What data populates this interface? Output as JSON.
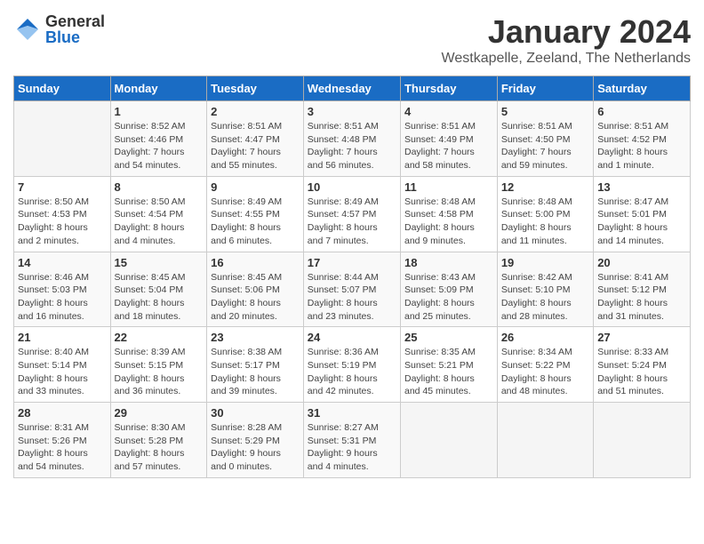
{
  "logo": {
    "general": "General",
    "blue": "Blue"
  },
  "title": "January 2024",
  "subtitle": "Westkapelle, Zeeland, The Netherlands",
  "days_of_week": [
    "Sunday",
    "Monday",
    "Tuesday",
    "Wednesday",
    "Thursday",
    "Friday",
    "Saturday"
  ],
  "weeks": [
    [
      {
        "day": "",
        "info": ""
      },
      {
        "day": "1",
        "info": "Sunrise: 8:52 AM\nSunset: 4:46 PM\nDaylight: 7 hours\nand 54 minutes."
      },
      {
        "day": "2",
        "info": "Sunrise: 8:51 AM\nSunset: 4:47 PM\nDaylight: 7 hours\nand 55 minutes."
      },
      {
        "day": "3",
        "info": "Sunrise: 8:51 AM\nSunset: 4:48 PM\nDaylight: 7 hours\nand 56 minutes."
      },
      {
        "day": "4",
        "info": "Sunrise: 8:51 AM\nSunset: 4:49 PM\nDaylight: 7 hours\nand 58 minutes."
      },
      {
        "day": "5",
        "info": "Sunrise: 8:51 AM\nSunset: 4:50 PM\nDaylight: 7 hours\nand 59 minutes."
      },
      {
        "day": "6",
        "info": "Sunrise: 8:51 AM\nSunset: 4:52 PM\nDaylight: 8 hours\nand 1 minute."
      }
    ],
    [
      {
        "day": "7",
        "info": "Sunrise: 8:50 AM\nSunset: 4:53 PM\nDaylight: 8 hours\nand 2 minutes."
      },
      {
        "day": "8",
        "info": "Sunrise: 8:50 AM\nSunset: 4:54 PM\nDaylight: 8 hours\nand 4 minutes."
      },
      {
        "day": "9",
        "info": "Sunrise: 8:49 AM\nSunset: 4:55 PM\nDaylight: 8 hours\nand 6 minutes."
      },
      {
        "day": "10",
        "info": "Sunrise: 8:49 AM\nSunset: 4:57 PM\nDaylight: 8 hours\nand 7 minutes."
      },
      {
        "day": "11",
        "info": "Sunrise: 8:48 AM\nSunset: 4:58 PM\nDaylight: 8 hours\nand 9 minutes."
      },
      {
        "day": "12",
        "info": "Sunrise: 8:48 AM\nSunset: 5:00 PM\nDaylight: 8 hours\nand 11 minutes."
      },
      {
        "day": "13",
        "info": "Sunrise: 8:47 AM\nSunset: 5:01 PM\nDaylight: 8 hours\nand 14 minutes."
      }
    ],
    [
      {
        "day": "14",
        "info": "Sunrise: 8:46 AM\nSunset: 5:03 PM\nDaylight: 8 hours\nand 16 minutes."
      },
      {
        "day": "15",
        "info": "Sunrise: 8:45 AM\nSunset: 5:04 PM\nDaylight: 8 hours\nand 18 minutes."
      },
      {
        "day": "16",
        "info": "Sunrise: 8:45 AM\nSunset: 5:06 PM\nDaylight: 8 hours\nand 20 minutes."
      },
      {
        "day": "17",
        "info": "Sunrise: 8:44 AM\nSunset: 5:07 PM\nDaylight: 8 hours\nand 23 minutes."
      },
      {
        "day": "18",
        "info": "Sunrise: 8:43 AM\nSunset: 5:09 PM\nDaylight: 8 hours\nand 25 minutes."
      },
      {
        "day": "19",
        "info": "Sunrise: 8:42 AM\nSunset: 5:10 PM\nDaylight: 8 hours\nand 28 minutes."
      },
      {
        "day": "20",
        "info": "Sunrise: 8:41 AM\nSunset: 5:12 PM\nDaylight: 8 hours\nand 31 minutes."
      }
    ],
    [
      {
        "day": "21",
        "info": "Sunrise: 8:40 AM\nSunset: 5:14 PM\nDaylight: 8 hours\nand 33 minutes."
      },
      {
        "day": "22",
        "info": "Sunrise: 8:39 AM\nSunset: 5:15 PM\nDaylight: 8 hours\nand 36 minutes."
      },
      {
        "day": "23",
        "info": "Sunrise: 8:38 AM\nSunset: 5:17 PM\nDaylight: 8 hours\nand 39 minutes."
      },
      {
        "day": "24",
        "info": "Sunrise: 8:36 AM\nSunset: 5:19 PM\nDaylight: 8 hours\nand 42 minutes."
      },
      {
        "day": "25",
        "info": "Sunrise: 8:35 AM\nSunset: 5:21 PM\nDaylight: 8 hours\nand 45 minutes."
      },
      {
        "day": "26",
        "info": "Sunrise: 8:34 AM\nSunset: 5:22 PM\nDaylight: 8 hours\nand 48 minutes."
      },
      {
        "day": "27",
        "info": "Sunrise: 8:33 AM\nSunset: 5:24 PM\nDaylight: 8 hours\nand 51 minutes."
      }
    ],
    [
      {
        "day": "28",
        "info": "Sunrise: 8:31 AM\nSunset: 5:26 PM\nDaylight: 8 hours\nand 54 minutes."
      },
      {
        "day": "29",
        "info": "Sunrise: 8:30 AM\nSunset: 5:28 PM\nDaylight: 8 hours\nand 57 minutes."
      },
      {
        "day": "30",
        "info": "Sunrise: 8:28 AM\nSunset: 5:29 PM\nDaylight: 9 hours\nand 0 minutes."
      },
      {
        "day": "31",
        "info": "Sunrise: 8:27 AM\nSunset: 5:31 PM\nDaylight: 9 hours\nand 4 minutes."
      },
      {
        "day": "",
        "info": ""
      },
      {
        "day": "",
        "info": ""
      },
      {
        "day": "",
        "info": ""
      }
    ]
  ]
}
